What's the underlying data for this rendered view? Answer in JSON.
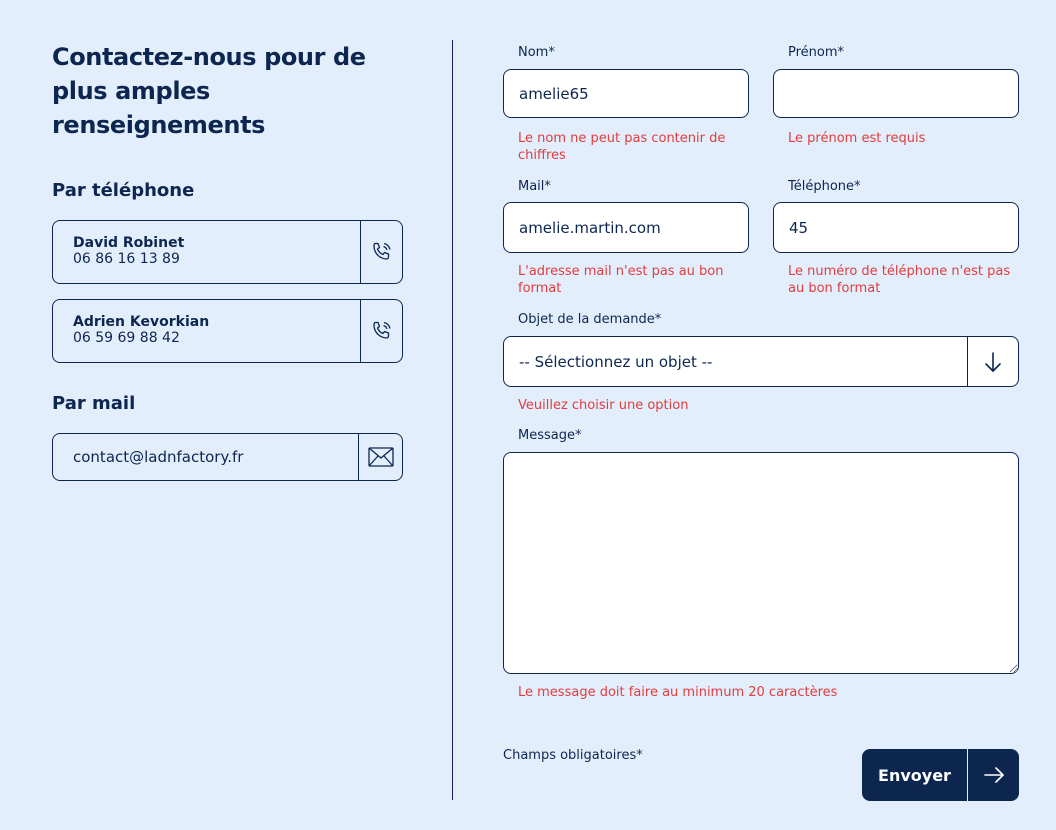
{
  "left": {
    "title": "Contactez-nous pour de plus amples renseignements",
    "phone_section": "Par téléphone",
    "contacts": [
      {
        "name": "David Robinet",
        "phone": "06 86 16 13 89",
        "icon": "phone-icon"
      },
      {
        "name": "Adrien Kevorkian",
        "phone": "06 59 69 88 42",
        "icon": "phone-icon"
      }
    ],
    "mail_section": "Par mail",
    "email": "contact@ladnfactory.fr",
    "email_icon": "mail-icon"
  },
  "form": {
    "nom": {
      "label": "Nom*",
      "value": "amelie65",
      "error": "Le nom ne peut pas contenir de chiffres"
    },
    "prenom": {
      "label": "Prénom*",
      "value": "",
      "error": "Le prénom est requis"
    },
    "mail": {
      "label": "Mail*",
      "value": "amelie.martin.com",
      "error": "L'adresse mail n'est pas au bon format"
    },
    "telephone": {
      "label": "Téléphone*",
      "value": "45",
      "error": "Le numéro de téléphone n'est pas au bon format"
    },
    "objet": {
      "label": "Objet de la demande*",
      "value": "-- Sélectionnez un objet --",
      "error": "Veuillez choisir une option"
    },
    "message": {
      "label": "Message*",
      "value": "",
      "error": "Le message doit faire au minimum 20 caractères"
    },
    "required_note": "Champs obligatoires*",
    "submit_label": "Envoyer"
  },
  "colors": {
    "background": "#e3eefc",
    "primary": "#0d2650",
    "error": "#e23c3c",
    "input_bg": "#ffffff"
  }
}
